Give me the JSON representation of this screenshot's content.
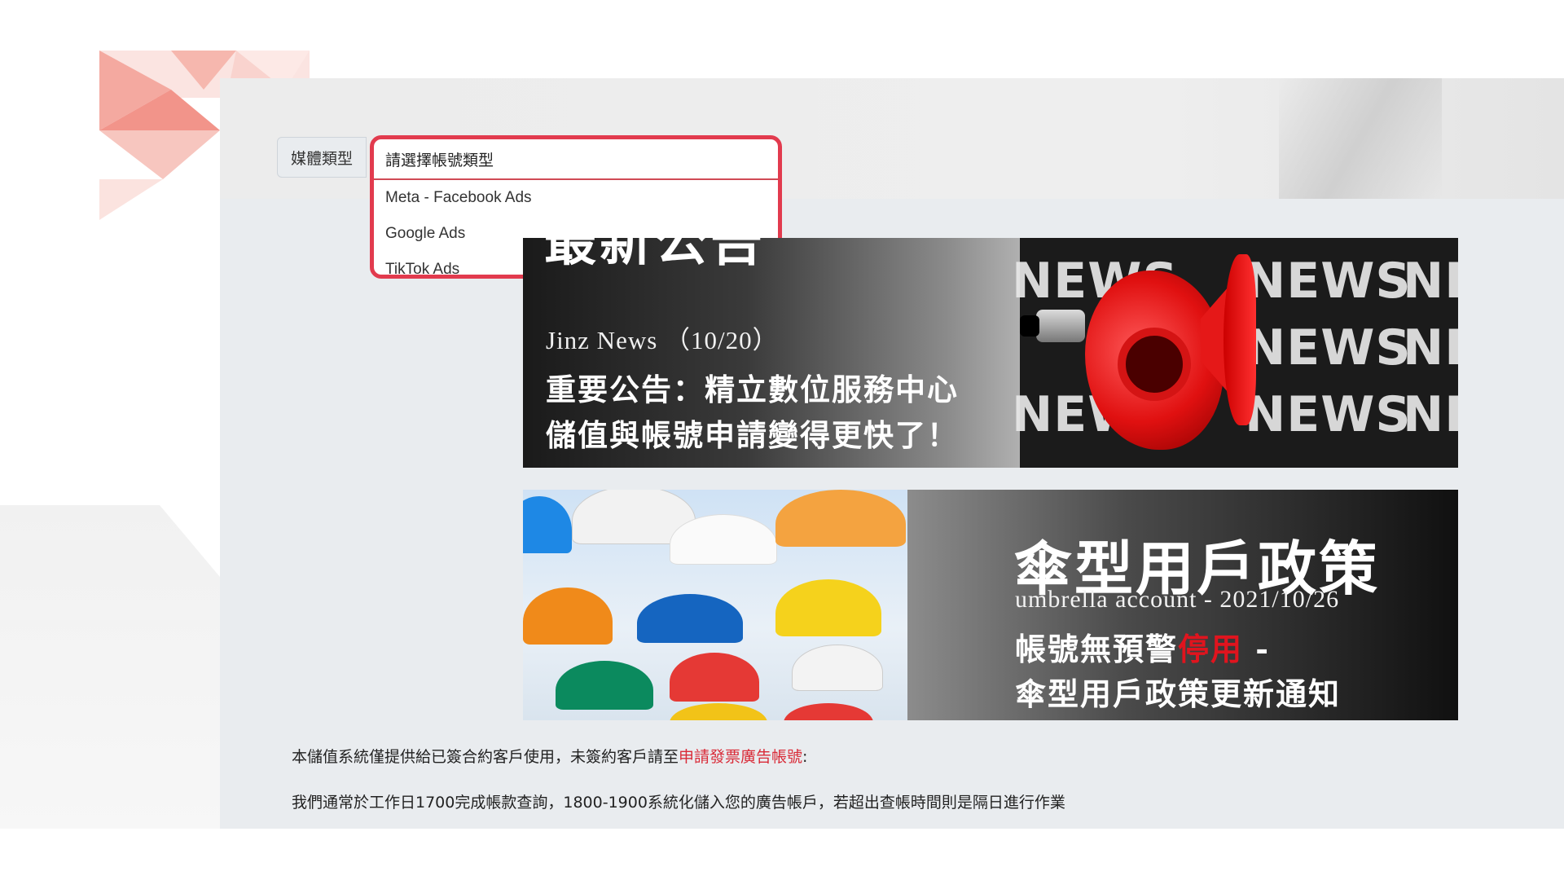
{
  "form": {
    "media_type_label": "媒體類型",
    "select_placeholder": "請選擇帳號類型",
    "options": [
      "Meta - Facebook Ads",
      "Google Ads",
      "TikTok Ads"
    ]
  },
  "banners": {
    "news": {
      "title_partial": "最新公告",
      "subtitle": "Jinz News （10/20）",
      "headline_line1": "重要公告：精立數位服務中心",
      "headline_line2": "儲值與帳號申請變得更快了！",
      "bg_words": [
        "NEWS",
        "NEWS",
        "NE",
        "NEWS",
        "NE",
        "NEWS",
        "NEWS",
        "NE"
      ]
    },
    "umbrella": {
      "title": "傘型用戶政策",
      "subtitle": "umbrella account - 2021/10/26",
      "line1_before": "帳號無預警",
      "line1_highlight": "停用",
      "line1_after": " -",
      "line2": "傘型用戶政策更新通知"
    }
  },
  "notices": {
    "line1_text": "本儲值系統僅提供給已簽合約客戶使用，未簽約客戶請至",
    "line1_link": "申請發票廣告帳號",
    "line1_end": ":",
    "line2": "我們通常於工作日1700完成帳款查詢，1800-1900系統化儲入您的廣告帳戶，若超出查帳時間則是隔日進行作業"
  },
  "colors": {
    "accent": "#e23b4e",
    "link": "#d92b38",
    "panel_bg": "#e9ecef"
  }
}
